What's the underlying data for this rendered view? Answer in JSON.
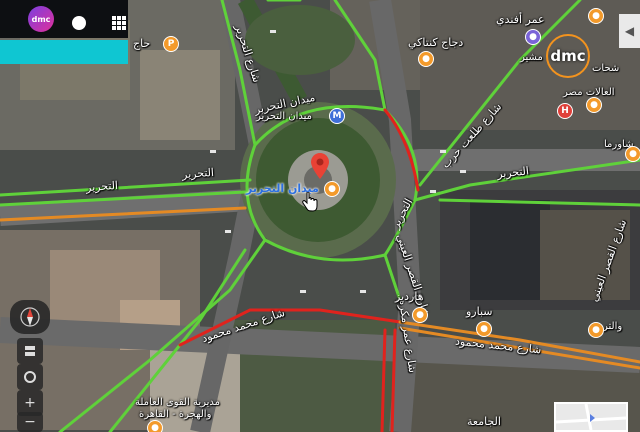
{
  "branding": {
    "channel_logo": "dmc",
    "corner_logo": "dmc"
  },
  "map": {
    "center_label": "ميدان التحرير",
    "metro_label": "ميدان التحرير",
    "streets": {
      "tahrir_w": "التحرير",
      "tahrir_w2": "التحرير",
      "tahrir_e": "التحرير",
      "tahrir_e2": "التحرير",
      "tahrir_ring": "ميدان التحرير",
      "talaat_harb": "شارع طلعت حرب",
      "tahrir_street_n": "شارع التحرير",
      "mohamed_mahmoud_w": "شارع محمد محمود",
      "mohamed_mahmoud_e": "شارع محمد محمود",
      "qasr_aini": "شارع القصر العيني",
      "qasr_aini_2": "شارع القصر العيني",
      "sherif_bldg": "شارع عمر مكرم"
    },
    "pois": {
      "omar_effendi": "عمر أفندي",
      "dajaj_kentaky": "دجاج كنتاكي",
      "moshir": "مشير",
      "shahat": "شحات",
      "alaalat_misr": "العالات مصر",
      "hardees": "هارديز",
      "sbarro": "سبارو",
      "mudiriya": "مديرية القوى العاملة",
      "mudiriya2": "والهجرة - القاهرة",
      "jamea": "الجامعة",
      "hajj": "حاج",
      "ambassador": "والتر",
      "shawerma": "شاورما"
    },
    "icons": {
      "parking": "P",
      "metro": "M",
      "hospital": "H",
      "food": "🍴"
    }
  },
  "controls": {
    "zoom_in": "+",
    "zoom_out": "−",
    "layers": "layers-icon",
    "locate": "locate-icon",
    "collapse": "◀"
  },
  "colors": {
    "traffic_green": "#5fd13a",
    "traffic_red": "#e0231d",
    "traffic_orange": "#e48a24",
    "accent_cyan": "#0fc6d2"
  }
}
